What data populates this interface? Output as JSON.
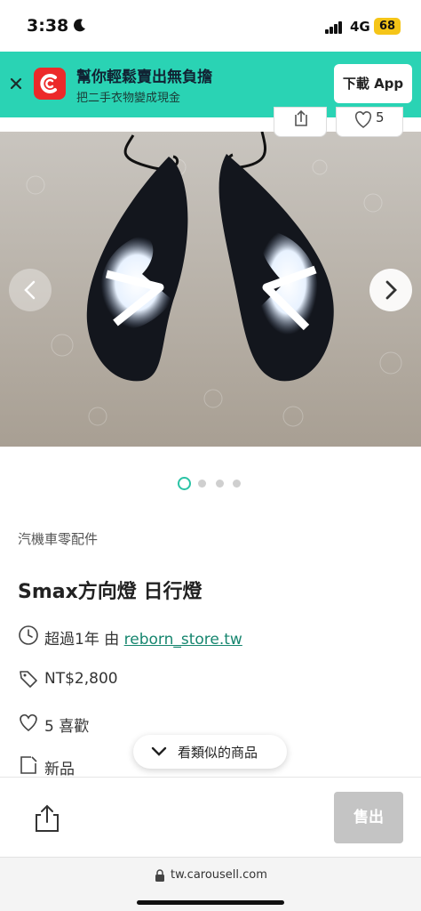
{
  "status_bar": {
    "time": "3:38",
    "network": "4G",
    "battery": "68"
  },
  "banner": {
    "title": "幫你輕鬆賣出無負擔",
    "subtitle": "把二手衣物變成現金",
    "download_label": "下載 App",
    "accent": "#2ad3b4"
  },
  "top_actions": {
    "like_count": "5"
  },
  "gallery": {
    "image_count": 4,
    "active_index": 0
  },
  "listing": {
    "category": "汽機車零配件",
    "title": "Smax方向燈 日行燈",
    "posted": "超過1年 由 ",
    "seller": "reborn_store.tw",
    "price": "NT$2,800",
    "likes": "5 喜歡",
    "condition": "新品"
  },
  "similar": {
    "label": "看類似的商品"
  },
  "bottom_bar": {
    "sell_label": "售出"
  },
  "browser": {
    "url": "tw.carousell.com"
  },
  "icons": {
    "moon": "moon-icon",
    "signal": "signal-icon",
    "close": "close-icon",
    "logo": "carousell-logo-icon",
    "share": "share-icon",
    "heart": "heart-icon",
    "chevron_left": "chevron-left-icon",
    "chevron_right": "chevron-right-icon",
    "clock": "clock-icon",
    "tag": "tag-icon",
    "condition": "condition-icon",
    "chevron_down": "chevron-down-icon",
    "lock": "lock-icon"
  }
}
